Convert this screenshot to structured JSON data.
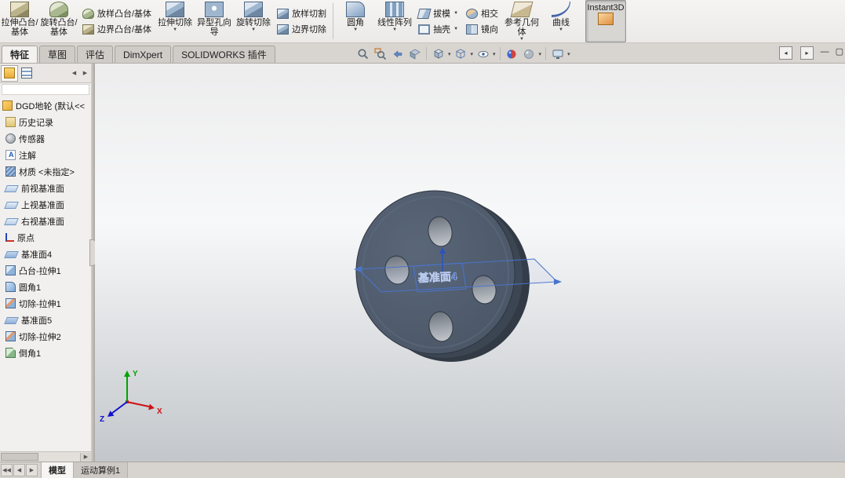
{
  "ribbon": {
    "buttons": [
      {
        "label": "拉伸凸台/基体"
      },
      {
        "label": "旋转凸台/基体"
      },
      {
        "label": "放样凸台/基体"
      },
      {
        "label": "边界凸台/基体"
      },
      {
        "label": "拉伸切除"
      },
      {
        "label": "异型孔向导"
      },
      {
        "label": "旋转切除"
      },
      {
        "label": "放样切割"
      },
      {
        "label": "边界切除"
      },
      {
        "label": "圆角"
      },
      {
        "label": "线性阵列"
      },
      {
        "label": "拔模"
      },
      {
        "label": "抽壳"
      },
      {
        "label": "相交"
      },
      {
        "label": "镜向"
      },
      {
        "label": "参考几何体"
      },
      {
        "label": "曲线"
      },
      {
        "label": "Instant3D"
      }
    ]
  },
  "command_tabs": {
    "items": [
      {
        "label": "特征"
      },
      {
        "label": "草图"
      },
      {
        "label": "评估"
      },
      {
        "label": "DimXpert"
      },
      {
        "label": "SOLIDWORKS 插件"
      }
    ]
  },
  "feature_tree": {
    "root": "DGD地轮 (默认<<",
    "items": [
      {
        "label": "历史记录"
      },
      {
        "label": "传感器"
      },
      {
        "label": "注解"
      },
      {
        "label": "材质 <未指定>"
      },
      {
        "label": "前视基准面"
      },
      {
        "label": "上视基准面"
      },
      {
        "label": "右视基准面"
      },
      {
        "label": "原点"
      },
      {
        "label": "基准面4"
      },
      {
        "label": "凸台-拉伸1"
      },
      {
        "label": "圆角1"
      },
      {
        "label": "切除-拉伸1"
      },
      {
        "label": "基准面5"
      },
      {
        "label": "切除-拉伸2"
      },
      {
        "label": "倒角1"
      }
    ]
  },
  "viewport": {
    "plane_label": "基准面4",
    "triad": {
      "x": "X",
      "y": "Y",
      "z": "Z"
    }
  },
  "statusbar": {
    "tabs": [
      {
        "label": "模型"
      },
      {
        "label": "运动算例1"
      }
    ]
  },
  "colors": {
    "plane_blue": "#4a74cc",
    "disc_face": "#4e5a6a",
    "viewport_top": "#f0f1f2",
    "viewport_bottom": "#c3c7cb"
  }
}
